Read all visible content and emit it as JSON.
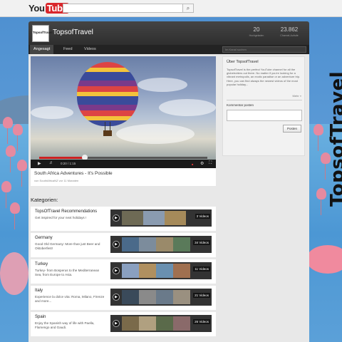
{
  "topbar": {
    "logo_you": "You",
    "logo_tube": "Tube",
    "search_placeholder": "",
    "search_icon": "search-icon"
  },
  "channel": {
    "avatar_text": "TopsofTravel",
    "title": "TopsofTravel",
    "stats": [
      {
        "value": "20",
        "label": "Hochgeladen"
      },
      {
        "value": "23.862",
        "label": "Channel-Aufrufe"
      }
    ],
    "tabs": [
      "Angesagt",
      "Feed",
      "Videos"
    ],
    "active_tab": "Angesagt",
    "search_placeholder": "Im Kanal suchen"
  },
  "player": {
    "time": "0:20 / 1:15",
    "progress": 0.27,
    "video_title": "South Africa Adventures - It's Possible",
    "video_meta": "von SouthAfricaNZ vor 11 Monaten"
  },
  "sidebar": {
    "about_title": "Über TopsofTravel",
    "about_text": "TopsofTravel is the perfect YouTube channel for all the globetrotters out there. No matter if you're looking for a vibrant metropolis, an exotic paradise or an adventure trip. Here, you can find always the newest videos of the most popular holiday...",
    "more_label": "Mehr »",
    "comment_title": "Kommentar posten",
    "post_label": "Posten"
  },
  "categories_label": "Kategorien:",
  "categories": [
    {
      "title": "TopsOfTravel Recommendations",
      "desc": "Get inspired for your next holidays !",
      "count": "3 Videos"
    },
    {
      "title": "Germany",
      "desc": "Good Old Germany: More than just Beer and Oktoberfest!",
      "count": "34 Videos"
    },
    {
      "title": "Turkey",
      "desc": "Turkey- from Bosperus to the Mediterranean Sea, from Europe to Asia.",
      "count": "11 Videos"
    },
    {
      "title": "Italy",
      "desc": "Experience la dolce vita: Roma, Milano, Firenze and more...",
      "count": "21 Videos"
    },
    {
      "title": "Spain",
      "desc": "Enjoy the Spanish way of life with Paella, Flamengo and Gaudi.",
      "count": "26 Videos"
    }
  ],
  "banner_text": "TopsofTravel",
  "colors": {
    "youtube_red": "#d9262b",
    "header_dark": "#2e2e2e",
    "progress_red": "#cc2222"
  }
}
